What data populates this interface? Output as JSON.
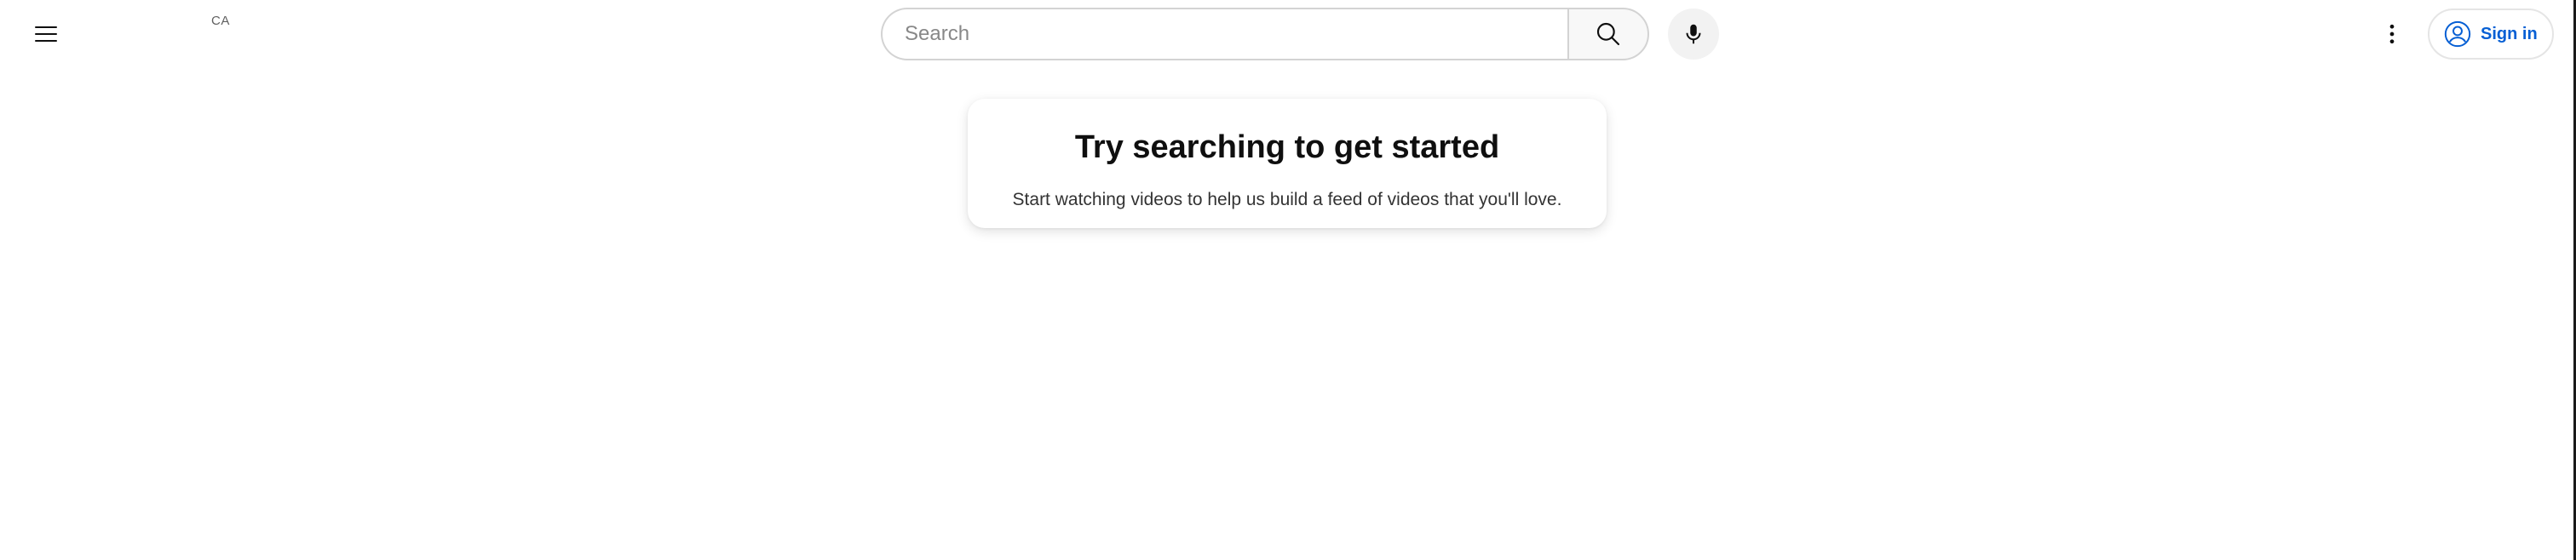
{
  "header": {
    "country_code": "CA",
    "search": {
      "placeholder": "Search",
      "value": ""
    },
    "sign_in_label": "Sign in",
    "icons": {
      "menu": "hamburger-menu-icon",
      "search": "search-icon",
      "mic": "microphone-icon",
      "more": "more-vertical-icon",
      "account": "account-circle-icon"
    }
  },
  "main": {
    "prompt": {
      "title": "Try searching to get started",
      "subtitle": "Start watching videos to help us build a feed of videos that you'll love."
    }
  },
  "colors": {
    "accent": "#065fd4",
    "text": "#0f0f0f",
    "border": "#d3d3d3",
    "button_bg": "#f2f2f2"
  }
}
